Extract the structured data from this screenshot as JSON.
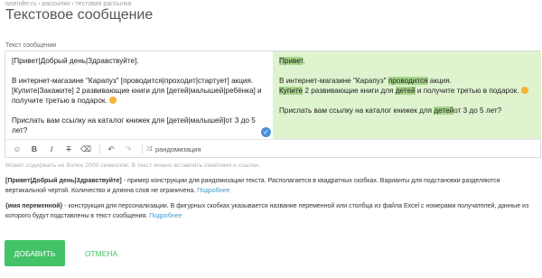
{
  "breadcrumb": "wsender.ru  ›  рассылки  ›  тестовая рассылка",
  "page_title": "Текстовое сообщение",
  "field_label": "Текст сообщения",
  "editor": {
    "line1": "[Привет|Добрый день|Здравствуйте].",
    "line2": "В интернет-магазине \"Карапуз\" [проводится|проходит|стартует] акция. [Купите|Закажите] 2 развивающие книги для [детей|малышей|ребёнка] и получите третью в подарок.",
    "line3": "Прислать вам ссылку на каталог книжек для [детей|малышей]от 3 до 5 лет?"
  },
  "preview": {
    "greeting": "Привет",
    "greeting_end": ".",
    "p2_a": "В интернет-магазине \"Карапуз\" ",
    "p2_hl1": "проводится",
    "p2_b": " акция.",
    "p2_hl2": "Купите",
    "p2_c": " 2 развивающие книги для ",
    "p2_hl3": "детей",
    "p2_d": " и получите третью в подарок.",
    "p3_a": "Прислать вам ссылку на каталог книжек для ",
    "p3_hl": "детей",
    "p3_b": "от 3 до 5 лет?"
  },
  "toolbar": {
    "emoji": "☺",
    "bold": "B",
    "italic": "I",
    "strike": "T",
    "clear": "⌫",
    "undo": "↶",
    "redo": "↷",
    "randomize_icon": "⤨",
    "randomize_label": "рандомизация"
  },
  "hint": "Может содержать не более 2000 символов. В текст можно вставлять смайлики и ссылки.",
  "help1": {
    "term": "[Привет|Добрый день|Здравствуйте]",
    "text": " - пример конструкции для рандомизации текста. Располагается в квадратных скобках. Варианты для подстановки разделяются вертикальной чертой. Количество и длинна слов не ограничена. ",
    "link": "Подробнее"
  },
  "help2": {
    "term": "{имя переменной}",
    "text": " - конструкция для персонализации. В фигурных скобках указывается название переменной или столбца из файла Excel с номерами получателей, данные из которого будут подставлены в текст сообщения. ",
    "link": "Подробнее"
  },
  "buttons": {
    "add": "ДОБАВИТЬ",
    "cancel": "ОТМЕНА"
  },
  "colors": {
    "accent": "#44c267",
    "preview_bg": "#dff3cf",
    "highlight": "#a7d58a",
    "link": "#3f9cd1"
  }
}
